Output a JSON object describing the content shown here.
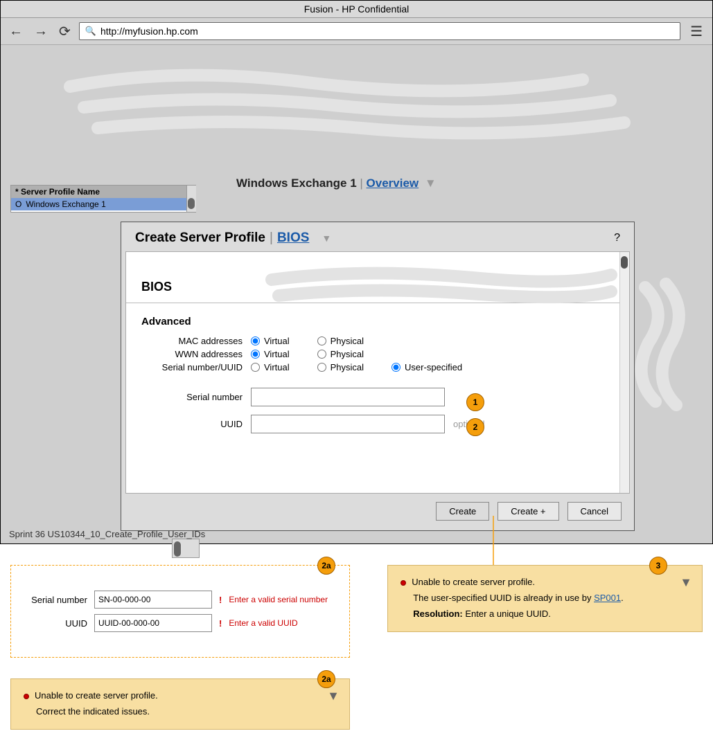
{
  "window": {
    "title": "Fusion - HP Confidential"
  },
  "address_bar": {
    "url": "http://myfusion.hp.com"
  },
  "sidebar": {
    "header": "* Server Profile Name",
    "row_prefix": "O",
    "row1": "Windows Exchange 1"
  },
  "page_header": {
    "title": "Windows Exchange 1",
    "section": "Overview"
  },
  "dialog": {
    "title": "Create Server Profile",
    "section": "BIOS",
    "help": "?",
    "bios_heading": "BIOS",
    "advanced_heading": "Advanced",
    "labels": {
      "mac": "MAC addresses",
      "wwn": "WWN addresses",
      "serial_uuid": "Serial number/UUID",
      "serial": "Serial number",
      "uuid": "UUID"
    },
    "options": {
      "virtual": "Virtual",
      "physical": "Physical",
      "user_specified": "User-specified"
    },
    "optional": "optional",
    "buttons": {
      "create": "Create",
      "create_plus": "Create +",
      "cancel": "Cancel"
    }
  },
  "sprint": "Sprint 36 US10344_10_Create_Profile_User_IDs",
  "callouts": {
    "c1": "1",
    "c2": "2",
    "c2a": "2a",
    "c3": "3"
  },
  "annot": {
    "serial_label": "Serial number",
    "uuid_label": "UUID",
    "serial_value": "SN-00-000-00",
    "uuid_value": "UUID-00-000-00",
    "excl": "!",
    "err_serial": "Enter a valid serial number",
    "err_uuid": "Enter a valid UUID",
    "warn1_title": "Unable to create server profile.",
    "warn1_body": "Correct the indicated issues.",
    "warn2_title": "Unable to create server profile.",
    "warn2_body_pre": "The user-specified UUID is already in use by ",
    "warn2_link": "SP001",
    "warn2_body_post": ".",
    "warn2_res_label": "Resolution:",
    "warn2_res": " Enter a unique UUID."
  }
}
